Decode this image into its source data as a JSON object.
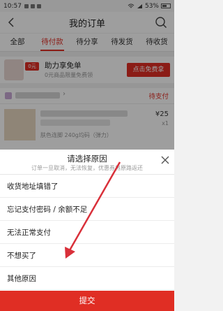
{
  "status_bar": {
    "time": "10:57",
    "battery": "53%"
  },
  "header": {
    "title": "我的订单"
  },
  "tabs": [
    {
      "label": "全部"
    },
    {
      "label": "待付款"
    },
    {
      "label": "待分享"
    },
    {
      "label": "待发货"
    },
    {
      "label": "待收货"
    }
  ],
  "promo": {
    "badge": "0元",
    "title": "助力享免单",
    "subtitle": "0元商品限量免费领",
    "button": "点击免费拿"
  },
  "order": {
    "status": "待支付",
    "spec": "肤色连脚 240g均码（弹力）",
    "price": "¥25",
    "quantity": "x1"
  },
  "dialog": {
    "title": "请选择原因",
    "subtitle": "订单一旦取消，无法恢复，优惠券将原路返还",
    "reasons": [
      {
        "label": "收货地址填错了"
      },
      {
        "label": "忘记支付密码 / 余额不足"
      },
      {
        "label": "无法正常支付"
      },
      {
        "label": "不想买了"
      },
      {
        "label": "其他原因"
      }
    ],
    "submit": "提交"
  },
  "colors": {
    "accent": "#e02e24",
    "annotation_arrow": "#d9303a"
  }
}
